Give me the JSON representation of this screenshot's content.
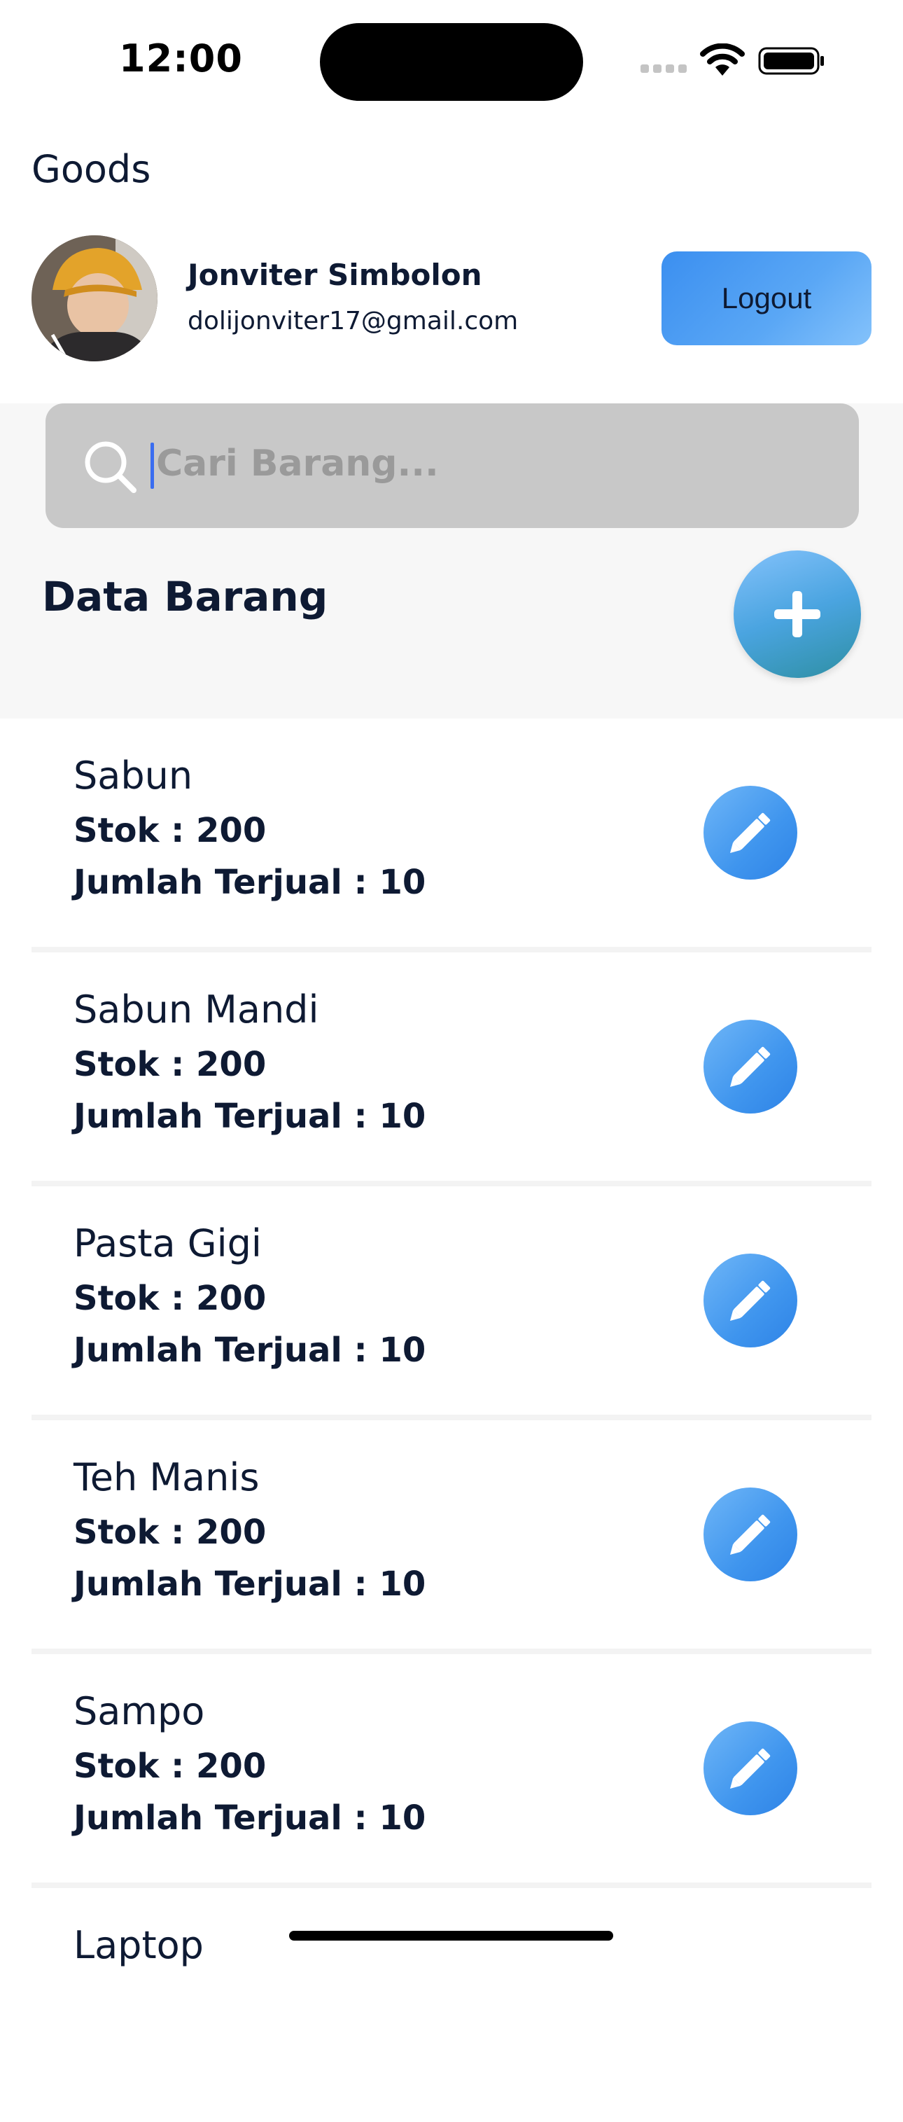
{
  "status_bar": {
    "time": "12:00"
  },
  "header": {
    "title": "Goods",
    "user": {
      "name": "Jonviter Simbolon",
      "email": "dolijonviter17@gmail.com"
    },
    "logout_label": "Logout"
  },
  "search": {
    "placeholder": "Cari Barang..."
  },
  "section": {
    "title": "Data Barang"
  },
  "items": [
    {
      "name": "Sabun",
      "stock": "Stok : 200",
      "sold": "Jumlah Terjual : 10"
    },
    {
      "name": "Sabun Mandi",
      "stock": "Stok : 200",
      "sold": "Jumlah Terjual : 10"
    },
    {
      "name": "Pasta Gigi",
      "stock": "Stok : 200",
      "sold": "Jumlah Terjual : 10"
    },
    {
      "name": "Teh Manis",
      "stock": "Stok : 200",
      "sold": "Jumlah Terjual : 10"
    },
    {
      "name": "Sampo",
      "stock": "Stok : 200",
      "sold": "Jumlah Terjual : 10"
    },
    {
      "name": "Laptop",
      "stock": "",
      "sold": ""
    }
  ],
  "icons": {
    "search": "search-icon",
    "add": "plus-icon",
    "edit": "pencil-icon",
    "wifi": "wifi-icon",
    "battery": "battery-icon"
  },
  "colors": {
    "accent_blue": "#3b8ff0",
    "text_dark": "#0e1a33",
    "search_bg": "#c8c8c8"
  }
}
